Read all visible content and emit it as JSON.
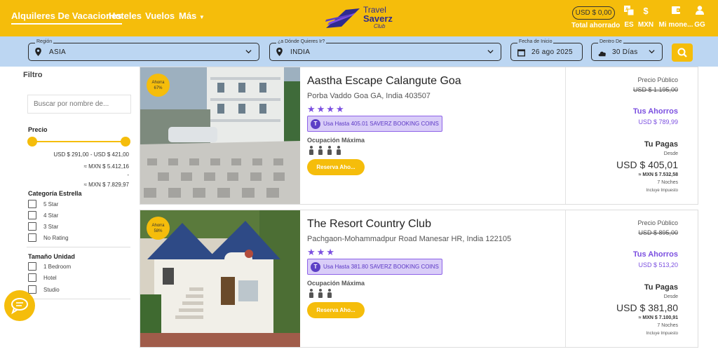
{
  "header": {
    "nav": [
      "Alquileres De Vacaciones",
      "Hoteles",
      "Vuelos",
      "Más"
    ],
    "logo": {
      "line1": "Travel",
      "line2": "Saverz",
      "line3": "Club"
    },
    "saved_amount": "USD $ 0,00",
    "saved_label": "Total ahorrado",
    "language": "ES",
    "currency": "MXN",
    "wallet_label": "Mi mone...",
    "user_initials": "GG",
    "colors": {
      "brand": "#f5bd0b",
      "accent": "#7b4fe0"
    }
  },
  "search": {
    "region": {
      "label": "Región",
      "value": "ASIA"
    },
    "destination": {
      "label": "¿a Dónde Quieres Ir?",
      "value": "INDIA"
    },
    "start_date": {
      "label": "Fecha de Inicio",
      "value": "26 ago 2025"
    },
    "within": {
      "label": "Dentro De",
      "value": "30 Días"
    }
  },
  "filters": {
    "title": "Filtro",
    "name_placeholder": "Buscar por nombre de...",
    "price_label": "Precio",
    "price_range": "USD $ 291,00  - USD $ 421,00",
    "mxn_min": "≈ MXN $ 5.412,16",
    "dash": "-",
    "mxn_max": "≈ MXN $ 7.829,97",
    "star_label": "Categoría Estrella",
    "stars": [
      "5 Star",
      "4 Star",
      "3 Star",
      "No Rating"
    ],
    "unit_label": "Tamaño Unidad",
    "units": [
      "1 Bedroom",
      "Hotel",
      "Studio"
    ]
  },
  "results": [
    {
      "badge_label": "Ahorra",
      "badge_pct": "67%",
      "name": "Aastha Escape Calangute Goa",
      "address": "Porba Vaddo Goa GA, India 403507",
      "stars": "★★★★",
      "coins": "Usa Hasta 405.01 SAVERZ BOOKING COINS",
      "occupancy_label": "Ocupación Máxima",
      "occupancy": 4,
      "reserve": "Reserva Aho...",
      "public_label": "Precio Público",
      "public_price": "USD $ 1.195,00",
      "savings_label": "Tus Ahorros",
      "savings": "USD $ 789,99",
      "pay_label": "Tu Pagas",
      "from_label": "Desde",
      "pay": "USD $ 405,01",
      "pay_mxn": "≈ MXN $ 7.532,58",
      "nights": "7 Noches",
      "tax": "Incluye Impuesto"
    },
    {
      "badge_label": "Ahorra",
      "badge_pct": "58%",
      "name": "The Resort Country Club",
      "address": "Pachgaon-Mohammadpur Road Manesar HR, India 122105",
      "stars": "★★★",
      "coins": "Usa Hasta 381.80 SAVERZ BOOKING COINS",
      "occupancy_label": "Ocupación Máxima",
      "occupancy": 3,
      "reserve": "Reserva Aho...",
      "public_label": "Precio Público",
      "public_price": "USD $ 895,00",
      "savings_label": "Tus Ahorros",
      "savings": "USD $ 513,20",
      "pay_label": "Tu Pagas",
      "from_label": "Desde",
      "pay": "USD $ 381,80",
      "pay_mxn": "≈ MXN $ 7.100,91",
      "nights": "7 Noches",
      "tax": "Incluye Impuesto"
    }
  ]
}
